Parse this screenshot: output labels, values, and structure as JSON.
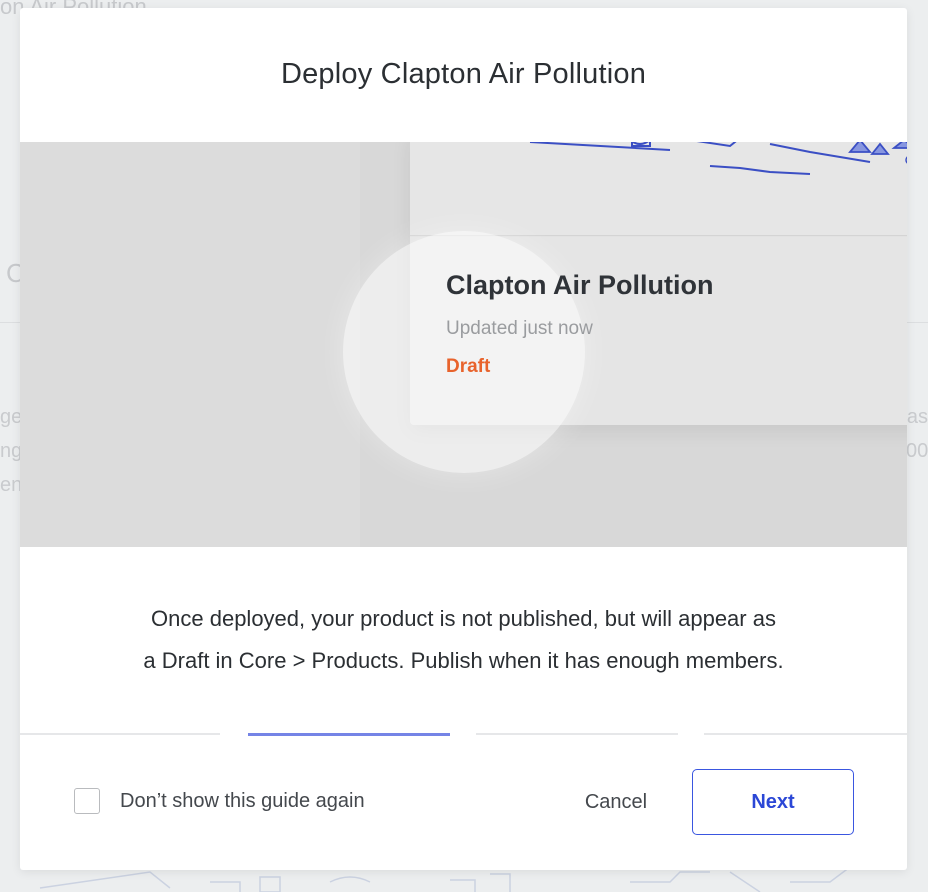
{
  "background": {
    "breadcrumb_fragment": "on Air Pollution",
    "letter_fragment": "C",
    "left_edge_fragments": [
      "ge",
      "ng",
      "en"
    ],
    "right_edge_fragments": [
      "as",
      "00"
    ]
  },
  "modal": {
    "title": "Deploy Clapton Air Pollution",
    "illustration": {
      "card_title": "Clapton Air Pollution",
      "card_updated": "Updated just now",
      "card_status": "Draft"
    },
    "description_line1": "Once deployed, your product is not published, but will appear as",
    "description_line2": "a Draft in Core > Products. Publish when it has enough members.",
    "steps": {
      "count": 4,
      "active_index": 1
    },
    "footer": {
      "checkbox_label": "Don’t show this guide again",
      "checkbox_checked": false,
      "cancel_label": "Cancel",
      "next_label": "Next"
    }
  },
  "colors": {
    "accent": "#3a56e0",
    "active_step": "#7584e6",
    "draft_status": "#e8632c"
  }
}
